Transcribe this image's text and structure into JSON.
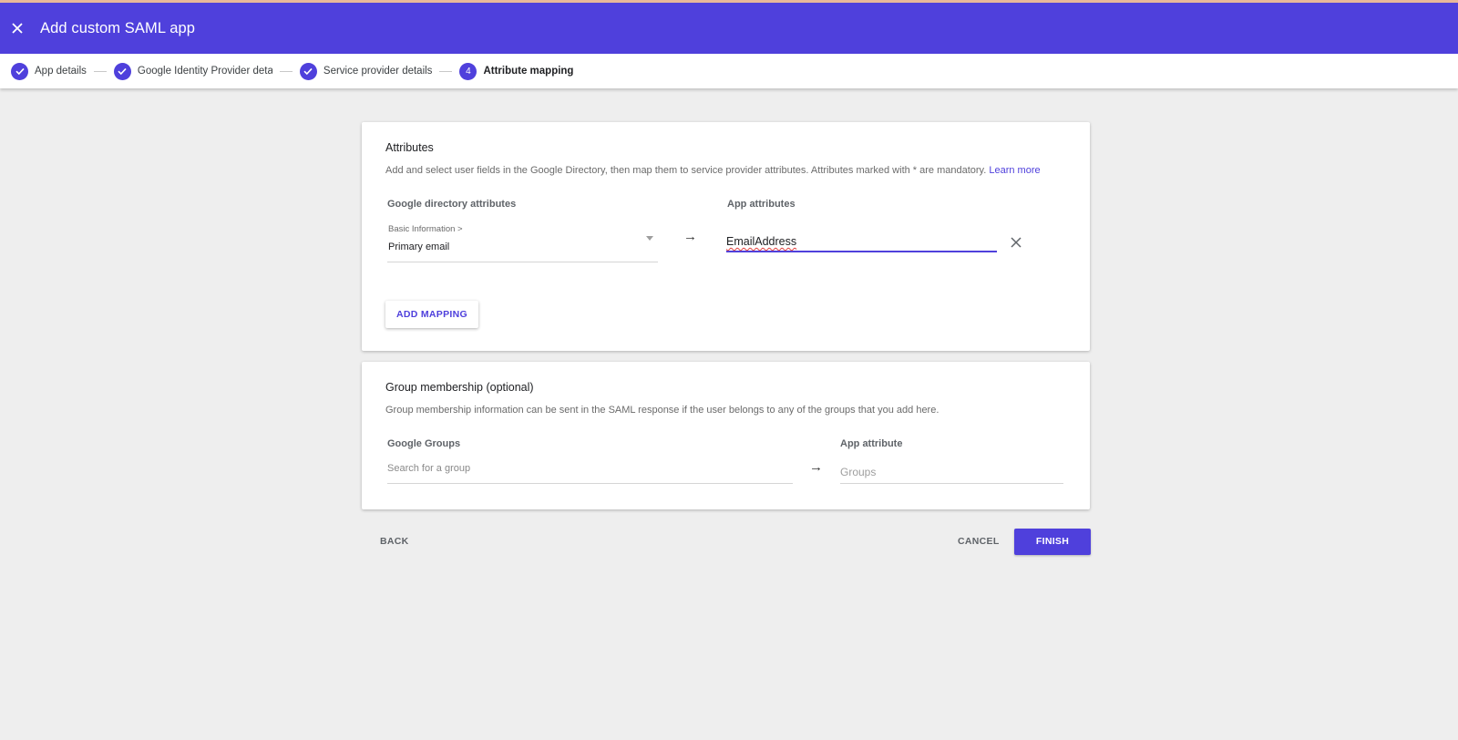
{
  "window": {
    "title": "Add custom SAML app"
  },
  "stepper": {
    "steps": [
      {
        "label": "App details",
        "state": "complete"
      },
      {
        "label": "Google Identity Provider detail",
        "state": "complete"
      },
      {
        "label": "Service provider details",
        "state": "complete"
      },
      {
        "label": "Attribute mapping",
        "state": "active",
        "number": "4"
      }
    ]
  },
  "attributes": {
    "title": "Attributes",
    "description": "Add and select user fields in the Google Directory, then map them to service provider attributes. Attributes marked with * are mandatory.",
    "learn_more": "Learn more",
    "google_col_header": "Google directory attributes",
    "app_col_header": "App attributes",
    "mapping": {
      "category": "Basic Information >",
      "google_value": "Primary email",
      "arrow": "→",
      "app_value": "EmailAddress"
    },
    "add_mapping_label": "ADD MAPPING"
  },
  "groups": {
    "title": "Group membership (optional)",
    "description": "Group membership information can be sent in the SAML response if the user belongs to any of the groups that you add here.",
    "google_col_header": "Google Groups",
    "app_col_header": "App attribute",
    "search_placeholder": "Search for a group",
    "arrow": "→",
    "app_placeholder": "Groups"
  },
  "footer": {
    "back_label": "BACK",
    "cancel_label": "CANCEL",
    "finish_label": "FINISH"
  },
  "colors": {
    "accent": "#4f40dc",
    "background": "#eeeeee"
  }
}
